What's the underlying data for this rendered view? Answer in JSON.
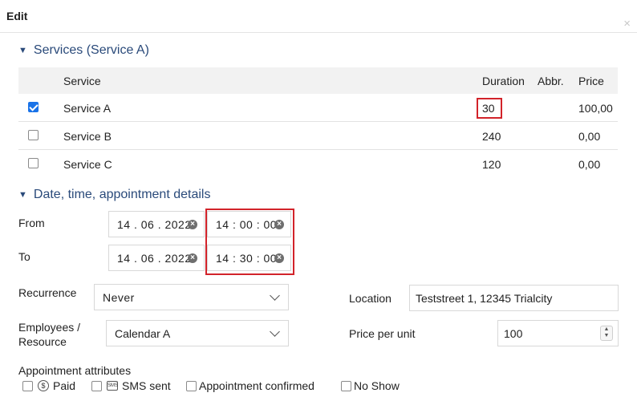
{
  "dialog": {
    "title": "Edit",
    "close_glyph": "×"
  },
  "services": {
    "heading": "Services (Service A)",
    "columns": {
      "service": "Service",
      "duration": "Duration",
      "abbr": "Abbr.",
      "price": "Price"
    },
    "rows": [
      {
        "name": "Service A",
        "duration": "30",
        "abbr": "",
        "price": "100,00",
        "checked": true
      },
      {
        "name": "Service B",
        "duration": "240",
        "abbr": "",
        "price": "0,00",
        "checked": false
      },
      {
        "name": "Service C",
        "duration": "120",
        "abbr": "",
        "price": "0,00",
        "checked": false
      }
    ]
  },
  "details": {
    "heading": "Date, time, appointment details",
    "from_label": "From",
    "to_label": "To",
    "from_date": "14 . 06 . 2022",
    "from_time": "14 : 00 : 00",
    "to_date": "14 . 06 . 2022",
    "to_time": "14 : 30 : 00",
    "recurrence_label": "Recurrence",
    "recurrence_value": "Never",
    "employees_label_line1": "Employees /",
    "employees_label_line2": "Resource",
    "employees_value": "Calendar A",
    "location_label": "Location",
    "location_value": "Teststreet 1, 12345 Trialcity",
    "price_unit_label": "Price per unit",
    "price_unit_value": "100"
  },
  "attributes": {
    "heading": "Appointment attributes",
    "items": {
      "paid": "Paid",
      "sms": "SMS sent",
      "confirmed": "Appointment confirmed",
      "noshow": "No Show"
    }
  },
  "icons": {
    "clear": "clear-icon",
    "chevron": "chevron-down-icon",
    "close": "close-icon"
  },
  "colors": {
    "accent": "#1a73e8",
    "heading": "#2a4a7a",
    "highlight": "#d2232a"
  }
}
